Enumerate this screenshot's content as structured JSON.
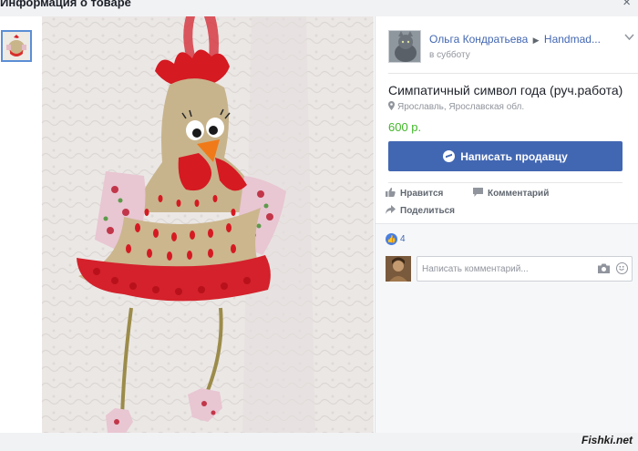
{
  "header": {
    "title": "Информация о товаре",
    "close_glyph": "×"
  },
  "seller": {
    "name": "Ольга Кондратьева",
    "group": "Handmad...",
    "date": "в субботу"
  },
  "product": {
    "title": "Симпатичный символ года (руч.работа)",
    "location": "Ярославль, Ярославская обл.",
    "price": "600 р.",
    "message_button": "Написать продавцу"
  },
  "actions": {
    "like": "Нравится",
    "comment": "Комментарий",
    "share": "Поделиться"
  },
  "likes_count": "4",
  "comment_input": {
    "placeholder": "Написать комментарий..."
  },
  "watermark": "Fishki.net",
  "colors": {
    "accent": "#4267b2",
    "price": "#42b72a"
  },
  "icons": [
    "close-icon",
    "chevron-down-icon",
    "location-pin-icon",
    "messenger-icon",
    "like-icon",
    "comment-icon",
    "share-icon",
    "camera-icon",
    "smiley-icon"
  ]
}
